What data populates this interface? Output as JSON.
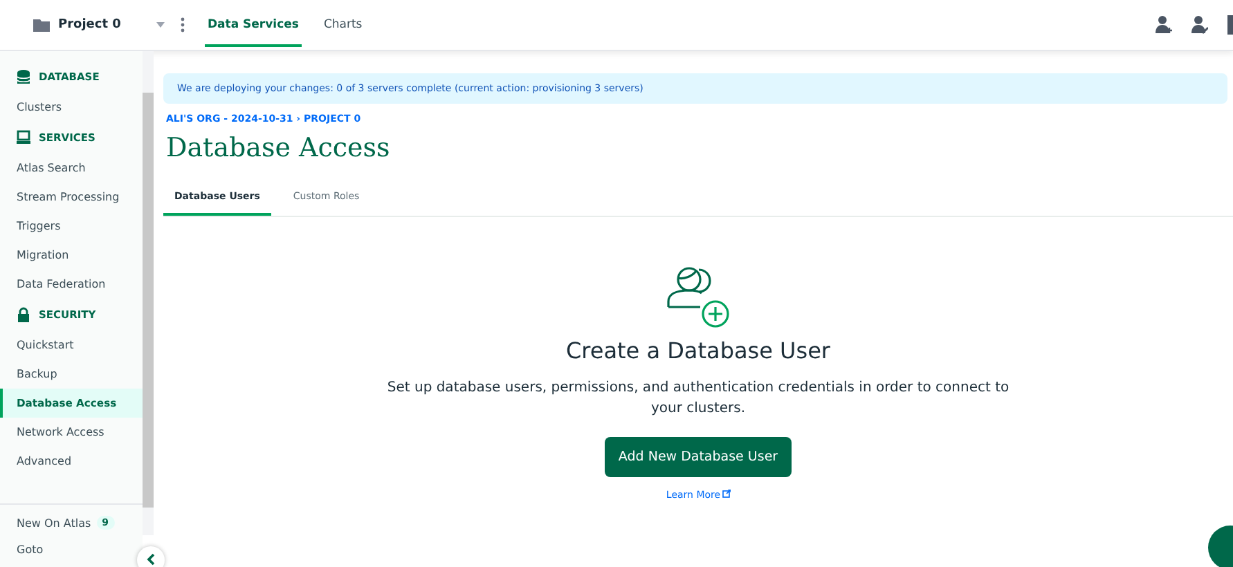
{
  "project": {
    "name": "Project 0"
  },
  "top_tabs": [
    {
      "label": "Data Services",
      "selected": true
    },
    {
      "label": "Charts",
      "selected": false
    }
  ],
  "sidebar": {
    "items": [
      {
        "kind": "section",
        "label": "DATABASE"
      },
      {
        "kind": "item",
        "label": "Clusters",
        "selected": false
      },
      {
        "kind": "section",
        "label": "SERVICES"
      },
      {
        "kind": "item",
        "label": "Atlas Search",
        "selected": false
      },
      {
        "kind": "item",
        "label": "Stream Processing",
        "selected": false
      },
      {
        "kind": "item",
        "label": "Triggers",
        "selected": false
      },
      {
        "kind": "item",
        "label": "Migration",
        "selected": false
      },
      {
        "kind": "item",
        "label": "Data Federation",
        "selected": false
      },
      {
        "kind": "section",
        "label": "SECURITY"
      },
      {
        "kind": "item",
        "label": "Quickstart",
        "selected": false
      },
      {
        "kind": "item",
        "label": "Backup",
        "selected": false
      },
      {
        "kind": "item",
        "label": "Database Access",
        "selected": true
      },
      {
        "kind": "item",
        "label": "Network Access",
        "selected": false
      },
      {
        "kind": "item",
        "label": "Advanced",
        "selected": false
      }
    ],
    "footer": [
      {
        "label": "New On Atlas",
        "badge": "9"
      },
      {
        "label": "Goto"
      }
    ]
  },
  "banner": "We are deploying your changes: 0 of 3 servers complete (current action: provisioning 3 servers)",
  "breadcrumb": "ALI'S ORG - 2024-10-31 › PROJECT 0",
  "page_title": "Database Access",
  "tabs": [
    {
      "label": "Database Users",
      "selected": true
    },
    {
      "label": "Custom Roles",
      "selected": false
    }
  ],
  "empty_state": {
    "title": "Create a Database User",
    "text": "Set up database users, permissions, and authentication credentials in order to connect to your clusters.",
    "button": "Add New Database User",
    "link": "Learn More"
  }
}
